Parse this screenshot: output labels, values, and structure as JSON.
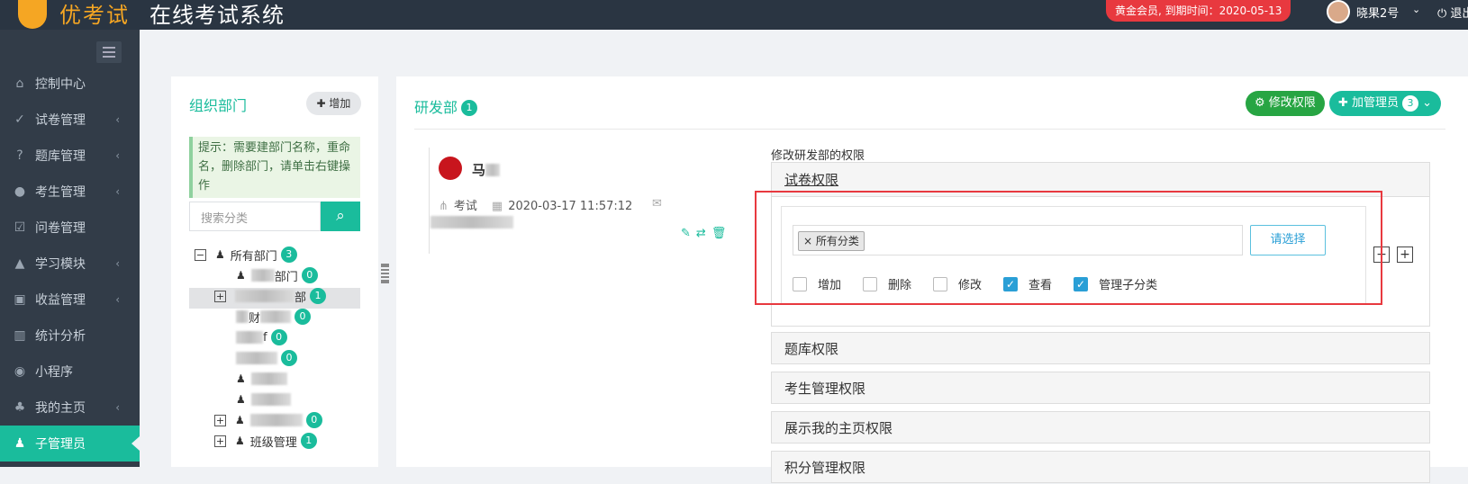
{
  "header": {
    "logo_text": "优考试",
    "system_title": "在线考试系统",
    "member_badge": "黄金会员, 到期时间：2020-05-13",
    "user_name": "晓果2号",
    "logout_label": "退出"
  },
  "sidebar": {
    "items": [
      {
        "label": "控制中心",
        "icon": "home-icon",
        "glyph": "⌂"
      },
      {
        "label": "试卷管理",
        "icon": "check-circle-icon",
        "glyph": "✓"
      },
      {
        "label": "题库管理",
        "icon": "question-circle-icon",
        "glyph": "?"
      },
      {
        "label": "考生管理",
        "icon": "user-icon",
        "glyph": "●"
      },
      {
        "label": "问卷管理",
        "icon": "checkbox-icon",
        "glyph": "☑"
      },
      {
        "label": "学习模块",
        "icon": "graduation-cap-icon",
        "glyph": "▲"
      },
      {
        "label": "收益管理",
        "icon": "money-icon",
        "glyph": "▣"
      },
      {
        "label": "统计分析",
        "icon": "bar-chart-icon",
        "glyph": "▥"
      },
      {
        "label": "小程序",
        "icon": "wechat-icon",
        "glyph": "◉"
      },
      {
        "label": "我的主页",
        "icon": "leaf-icon",
        "glyph": "♣"
      },
      {
        "label": "子管理员",
        "icon": "user-secret-icon",
        "glyph": "♟"
      }
    ]
  },
  "org": {
    "title": "组织部门",
    "add_label": "增加",
    "tip": "提示：需要建部门名称，重命名，删除部门，请单击右键操作",
    "search_placeholder": "搜索分类",
    "tree": [
      {
        "label": "所有部门",
        "count": "3"
      },
      {
        "label": "部门",
        "count": "0"
      },
      {
        "label": "部",
        "count": "1"
      },
      {
        "label": "财",
        "count": "0"
      },
      {
        "label": "f",
        "count": "0"
      },
      {
        "label": "",
        "count": "0"
      },
      {
        "label": "",
        "count": ""
      },
      {
        "label": "",
        "count": ""
      },
      {
        "label": "",
        "count": "0"
      },
      {
        "label": "班级管理",
        "count": "1"
      }
    ]
  },
  "main": {
    "dept_name": "研发部",
    "dept_count": "1",
    "modify_perm_label": "修改权限",
    "add_admin_label": "加管理员",
    "add_admin_count": "3",
    "member": {
      "name": "马",
      "role": "考试",
      "date": "2020-03-17 11:57:12"
    },
    "perm_heading": "修改研发部的权限",
    "sections": [
      {
        "title": "试卷权限"
      },
      {
        "title": "题库权限"
      },
      {
        "title": "考生管理权限"
      },
      {
        "title": "展示我的主页权限"
      },
      {
        "title": "积分管理权限"
      }
    ],
    "selected_tag": "所有分类",
    "select_button": "请选择",
    "checkboxes": [
      {
        "label": "增加",
        "checked": false
      },
      {
        "label": "删除",
        "checked": false
      },
      {
        "label": "修改",
        "checked": false
      },
      {
        "label": "查看",
        "checked": true
      },
      {
        "label": "管理子分类",
        "checked": true
      }
    ],
    "collapse_glyph": "−",
    "expand_glyph": "+"
  }
}
